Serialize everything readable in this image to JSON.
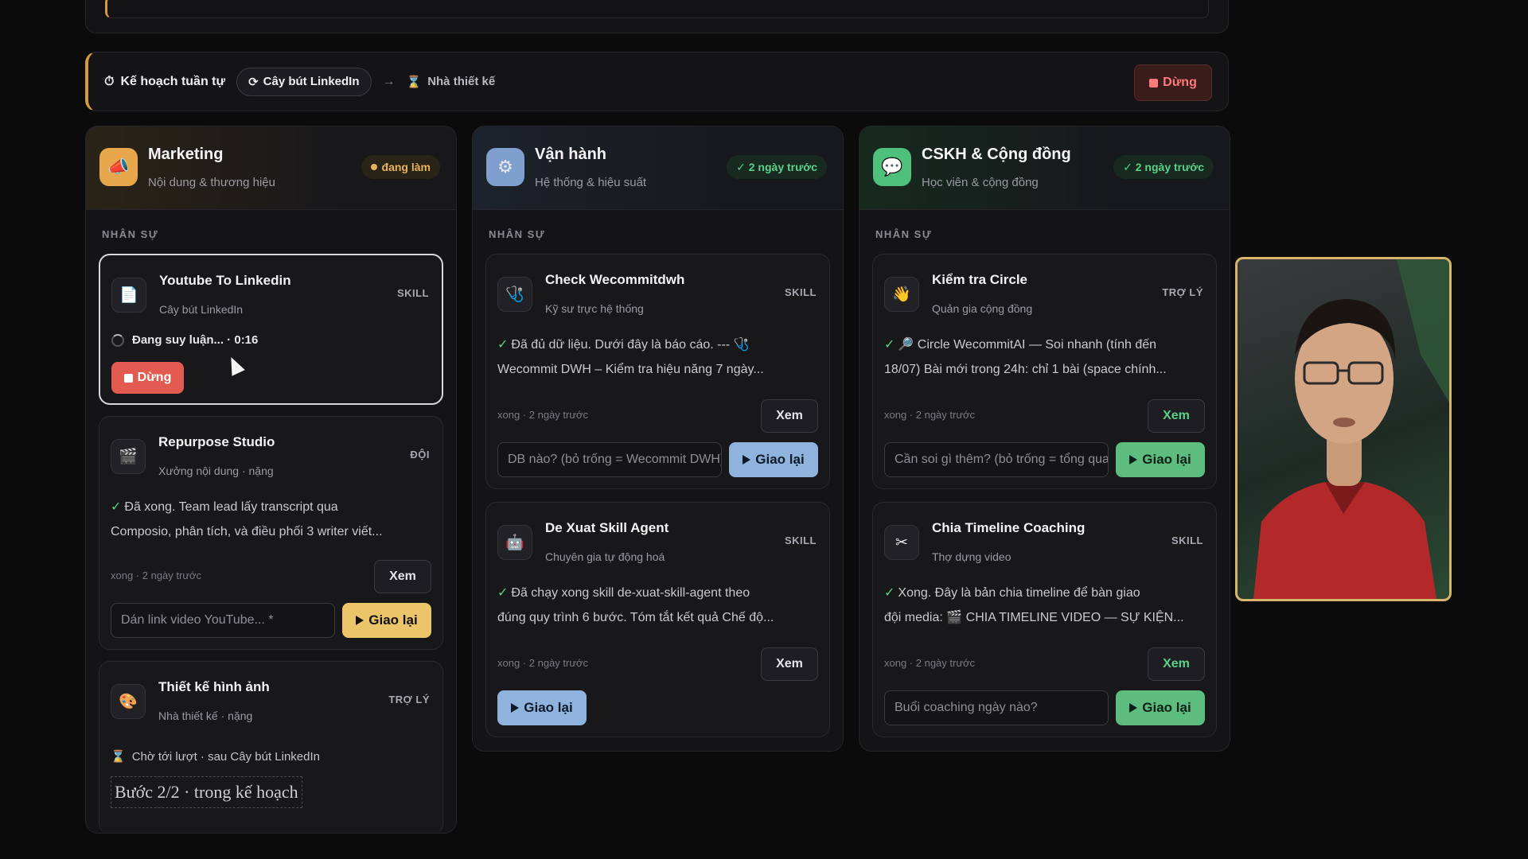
{
  "plan": {
    "title": "Kế hoạch tuần tự",
    "step1": "Cây bút LinkedIn",
    "step2": "Nhà thiết kế",
    "stop_label": "Dừng"
  },
  "columns": [
    {
      "title": "Marketing",
      "subtitle": "Nội dung & thương hiệu",
      "status": "đang làm",
      "section_label": "NHÂN SỰ",
      "cards": [
        {
          "title": "Youtube To Linkedin",
          "role": "Cây bút LinkedIn",
          "tag": "SKILL",
          "status": "Đang suy luận... · 0:16",
          "stop_label": "Dừng"
        },
        {
          "title": "Repurpose Studio",
          "role": "Xưởng nội dung · nặng",
          "tag": "ĐỘI",
          "line1": "Đã xong. Team lead lấy transcript qua",
          "line2": "Composio, phân tích, và điều phối 3 writer viết...",
          "meta": "xong · 2 ngày trước",
          "view_label": "Xem",
          "input_placeholder": "Dán link video YouTube... *",
          "retry_label": "Giao lại"
        },
        {
          "title": "Thiết kế hình ảnh",
          "role": "Nhà thiết kế · nặng",
          "tag": "TRỢ LÝ",
          "wait": "Chờ tới lượt · sau Cây bút LinkedIn",
          "step": "Bước 2/2 · trong kế hoạch"
        }
      ]
    },
    {
      "title": "Vận hành",
      "subtitle": "Hệ thống & hiệu suất",
      "status": "✓ 2 ngày trước",
      "section_label": "NHÂN SỰ",
      "cards": [
        {
          "title": "Check Wecommitdwh",
          "role": "Kỹ sư trực hệ thống",
          "tag": "SKILL",
          "line1": "Đã đủ dữ liệu. Dưới đây là báo cáo. --- 🩺",
          "line2": "Wecommit DWH – Kiểm tra hiệu năng 7 ngày...",
          "meta": "xong · 2 ngày trước",
          "view_label": "Xem",
          "input_placeholder": "DB nào? (bỏ trống = Wecommit DWH)",
          "retry_label": "Giao lại"
        },
        {
          "title": "De Xuat Skill Agent",
          "role": "Chuyên gia tự động hoá",
          "tag": "SKILL",
          "line1": "Đã chạy xong skill de-xuat-skill-agent theo",
          "line2": "đúng quy trình 6 bước. Tóm tắt kết quả Chế độ...",
          "meta": "xong · 2 ngày trước",
          "view_label": "Xem",
          "retry_label": "Giao lại"
        }
      ]
    },
    {
      "title": "CSKH & Cộng đồng",
      "subtitle": "Học viên & cộng đồng",
      "status": "✓ 2 ngày trước",
      "section_label": "NHÂN SỰ",
      "cards": [
        {
          "title": "Kiểm tra Circle",
          "role": "Quản gia cộng đồng",
          "tag": "TRỢ LÝ",
          "line1": "🔎 Circle WecommitAI — Soi nhanh (tính đến",
          "line2": "18/07) Bài mới trong 24h: chỉ 1 bài (space chính...",
          "meta": "xong · 2 ngày trước",
          "view_label": "Xem",
          "input_placeholder": "Cần soi gì thêm? (bỏ trống = tổng quan)",
          "retry_label": "Giao lại"
        },
        {
          "title": "Chia Timeline Coaching",
          "role": "Thợ dựng video",
          "tag": "SKILL",
          "line1": "Xong. Đây là bản chia timeline để bàn giao",
          "line2": "đội media: 🎬 CHIA TIMELINE VIDEO — SỰ KIỆN...",
          "meta": "xong · 2 ngày trước",
          "view_label": "Xem",
          "input_placeholder": "Buổi coaching ngày nào?",
          "retry_label": "Giao lại"
        }
      ]
    }
  ],
  "colors": {
    "accent_gold": "#ecc56a",
    "accent_blue": "#8fb3dc",
    "accent_green": "#5cbd7e",
    "stop_red": "#e25a50",
    "working": "#e7b35a",
    "done": "#5ad08a"
  },
  "icons": {
    "plan": "timer-icon",
    "step1": "refresh-icon",
    "step2": "hourglass-icon",
    "marketing": "megaphone-icon",
    "operations": "gear-icon",
    "community": "chat-bubble-icon"
  }
}
